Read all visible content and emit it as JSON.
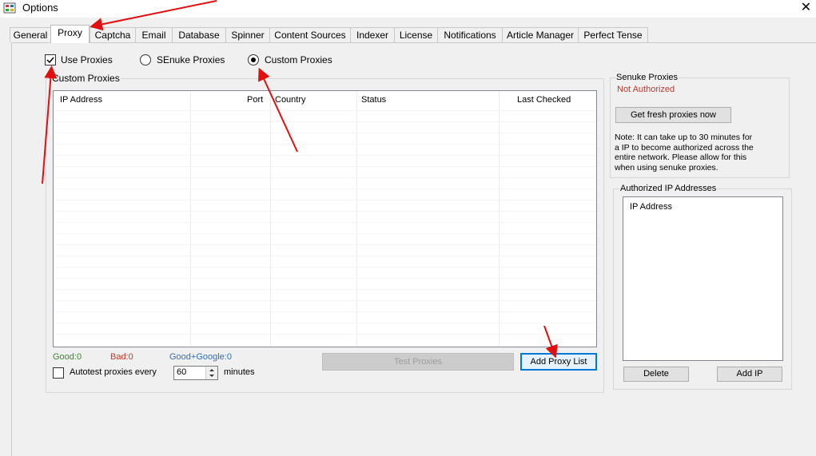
{
  "window": {
    "title": "Options",
    "close_glyph": "✕"
  },
  "tabs": [
    "General",
    "Proxy",
    "Captcha",
    "Email",
    "Database",
    "Spinner",
    "Content Sources",
    "Indexer",
    "License",
    "Notifications",
    "Article Manager",
    "Perfect Tense"
  ],
  "options": {
    "use_proxies_label": "Use Proxies",
    "senuke_proxies_label": "SEnuke Proxies",
    "custom_proxies_label": "Custom Proxies"
  },
  "custom_proxies": {
    "group_title": "Custom Proxies",
    "columns": [
      "IP Address",
      "Port",
      "Country",
      "Status",
      "Last Checked"
    ],
    "stats": {
      "good": "Good:0",
      "bad": "Bad:0",
      "good_google": "Good+Google:0"
    },
    "test_button": "Test Proxies",
    "add_button": "Add Proxy List",
    "autotest_label": "Autotest proxies every",
    "autotest_value": "60",
    "minutes_label": "minutes"
  },
  "senuke_proxies": {
    "group_title": "Senuke Proxies",
    "status": "Not Authorized",
    "fresh_button": "Get fresh proxies now",
    "note_lines": [
      "Note: It can take up to 30 minutes for",
      "a IP to become authorized across the",
      "entire network. Please allow for this",
      "when using senuke proxies."
    ]
  },
  "authorized": {
    "group_title": "Authorized IP Addresses",
    "column": "IP Address",
    "delete_button": "Delete",
    "add_button": "Add IP"
  },
  "colors": {
    "good": "#3a8a2a",
    "bad": "#c0392b",
    "good_google": "#2f6fb5",
    "not_authorized": "#c0392b",
    "arrow": "#e01010",
    "focus": "#0078d7"
  }
}
